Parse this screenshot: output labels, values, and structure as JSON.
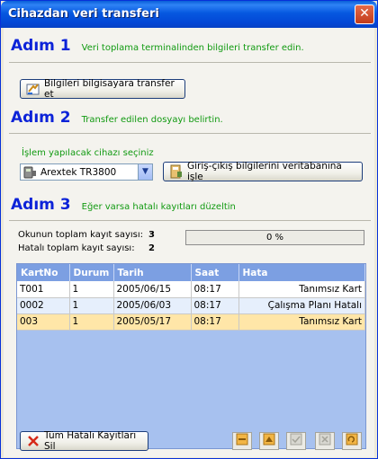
{
  "window": {
    "title": "Cihazdan veri transferi",
    "close_glyph": "✕"
  },
  "step1": {
    "title": "Adım 1",
    "desc": "Veri toplama terminalinden bilgileri transfer edin.",
    "button_label": "Bilgileri bilgisayara transfer et",
    "button_icon": "transfer-icon"
  },
  "step2": {
    "title": "Adım 2",
    "desc": "Transfer edilen dosyayı belirtin.",
    "device_label": "İşlem yapılacak cihazı seçiniz",
    "device_selected": "Arextek TR3800",
    "process_button_label": "Giriş-çıkış bilgilerini veritabanına işle"
  },
  "step3": {
    "title": "Adım 3",
    "desc": "Eğer varsa hatalı kayıtları düzeltin",
    "read_label": "Okunun toplam kayıt sayısı:",
    "read_count": "3",
    "error_label": "Hatalı toplam kayıt sayısı:",
    "error_count": "2",
    "progress_text": "0 %",
    "progress_value": 0
  },
  "grid": {
    "columns": [
      "KartNo",
      "Durum",
      "Tarih",
      "Saat",
      "Hata"
    ],
    "rows": [
      {
        "kartno": "T001",
        "durum": "1",
        "tarih": "2005/06/15",
        "saat": "08:17",
        "hata": "Tanımsız Kart"
      },
      {
        "kartno": "0002",
        "durum": "1",
        "tarih": "2005/06/03",
        "saat": "08:17",
        "hata": "Çalışma Planı Hatalı"
      },
      {
        "kartno": "003",
        "durum": "1",
        "tarih": "2005/05/17",
        "saat": "08:17",
        "hata": "Tanımsız Kart"
      }
    ]
  },
  "footer": {
    "delete_all_label": "Tüm Hatalı Kayıtları Sil"
  },
  "colors": {
    "step_title": "#0c23d8",
    "step_desc": "#119a11",
    "grid_header": "#7c9fe2",
    "grid_body": "#a7c1ef",
    "selected_row": "#ffe6a8"
  }
}
